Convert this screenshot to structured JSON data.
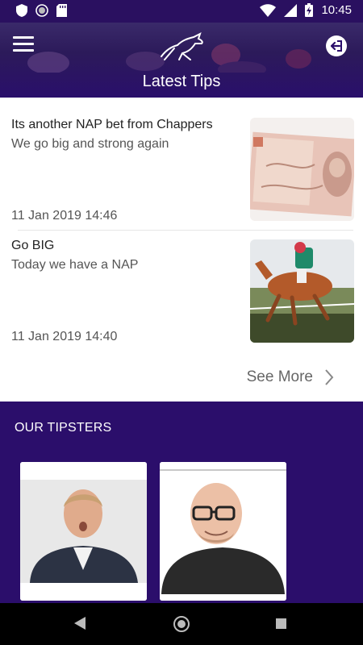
{
  "status_bar": {
    "time": "10:45"
  },
  "header": {
    "title": "Latest Tips"
  },
  "tips": [
    {
      "title": "Its another NAP bet from Chappers",
      "subtitle": "We go big and strong again",
      "date": "11 Jan 2019 14:46",
      "thumb": "banknote-image"
    },
    {
      "title": "Go BIG",
      "subtitle": "Today we have a NAP",
      "date": "11 Jan 2019 14:40",
      "thumb": "horse-racing-image"
    }
  ],
  "see_more": {
    "label": "See More"
  },
  "tipsters": {
    "heading": "OUR TIPSTERS",
    "cards": [
      "tipster-photo-1",
      "tipster-photo-2"
    ]
  },
  "colors": {
    "brand_purple": "#2b0e6b",
    "white": "#ffffff"
  }
}
